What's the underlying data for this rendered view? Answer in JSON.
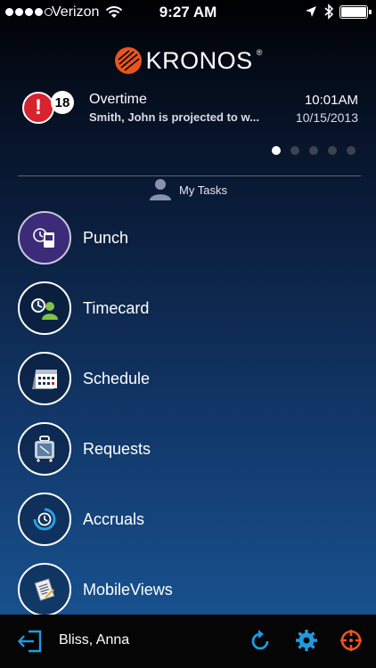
{
  "status_bar": {
    "carrier": "Verizon",
    "time": "9:27 AM",
    "signal_bars": 4
  },
  "logo": {
    "text": "KRONOS",
    "registered": "®"
  },
  "notification": {
    "count": "18",
    "alert_symbol": "!",
    "title": "Overtime",
    "body": "Smith, John  is projected to w...",
    "time": "10:01AM",
    "date": "10/15/2013"
  },
  "pager": {
    "pages": 5,
    "active_index": 0
  },
  "tasks_header": {
    "label": "My Tasks"
  },
  "tasks": [
    {
      "label": "Punch",
      "icon": "punch-clock-icon",
      "active": true
    },
    {
      "label": "Timecard",
      "icon": "timecard-icon",
      "active": false
    },
    {
      "label": "Schedule",
      "icon": "calendar-icon",
      "active": false
    },
    {
      "label": "Requests",
      "icon": "suitcase-icon",
      "active": false
    },
    {
      "label": "Accruals",
      "icon": "accruals-clock-icon",
      "active": false
    },
    {
      "label": "MobileViews",
      "icon": "document-icon",
      "active": false
    }
  ],
  "footer": {
    "user_name": "Bliss, Anna"
  },
  "colors": {
    "accent_blue": "#1e9be0",
    "alert_red": "#d7232e",
    "brand_orange": "#e9541f",
    "active_task": "#3b2b78"
  }
}
